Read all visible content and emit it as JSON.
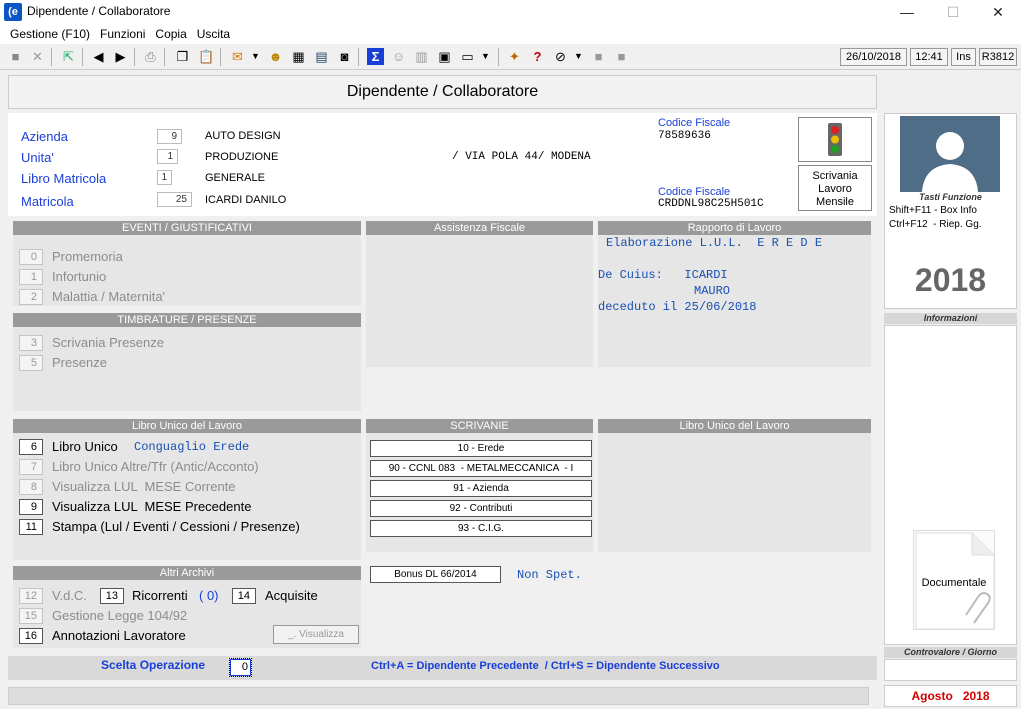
{
  "window": {
    "title": "Dipendente / Collaboratore",
    "app_icon": "(e",
    "minimize": "—",
    "maximize": "☐",
    "close": "✕"
  },
  "menu": [
    "Gestione (F10)",
    "Funzioni",
    "Copia",
    "Uscita"
  ],
  "status": {
    "date": "26/10/2018",
    "time": "12:41",
    "mode": "Ins",
    "code": "R3812"
  },
  "header": {
    "title": "Dipendente / Collaboratore"
  },
  "fields": {
    "azienda": {
      "label": "Azienda",
      "code": "9",
      "value": "AUTO DESIGN"
    },
    "unita": {
      "label": "Unita'",
      "code": "1",
      "value": "PRODUZIONE",
      "address": "/ VIA POLA 44/ MODENA"
    },
    "libro": {
      "label": "Libro Matricola",
      "code": "1",
      "value": "GENERALE"
    },
    "matricola": {
      "label": "Matricola",
      "code": "25",
      "value": "ICARDI DANILO"
    },
    "cf1": {
      "label": "Codice Fiscale",
      "value": "78589636"
    },
    "cf2": {
      "label": "Codice Fiscale",
      "value": "CRDDNL98C25H501C"
    }
  },
  "scrivania_btn": "Scrivania Lavoro Mensile",
  "eventi": {
    "title": "EVENTI / GIUSTIFICATIVI",
    "items": [
      {
        "num": "0",
        "label": "Promemoria"
      },
      {
        "num": "1",
        "label": "Infortunio"
      },
      {
        "num": "2",
        "label": "Malattia / Maternita'"
      }
    ]
  },
  "timbrature": {
    "title": "TIMBRATURE / PRESENZE",
    "items": [
      {
        "num": "3",
        "label": "Scrivania Presenze"
      },
      {
        "num": "5",
        "label": "Presenze"
      }
    ]
  },
  "assistenza": {
    "title": "Assistenza Fiscale"
  },
  "rapporto": {
    "title": "Rapporto di Lavoro",
    "line1": "Elaborazione L.U.L.  E R E D E",
    "line2": "De Cuius:   ICARDI",
    "line3": "MAURO",
    "line4": "deceduto il 25/06/2018"
  },
  "lul": {
    "title": "Libro Unico  del Lavoro",
    "items": [
      {
        "num": "6",
        "label": "Libro Unico",
        "extra": "Conguaglio Erede"
      },
      {
        "num": "7",
        "label": "Libro Unico Altre/Tfr (Antic/Acconto)"
      },
      {
        "num": "8",
        "label": "Visualizza LUL  MESE Corrente"
      },
      {
        "num": "9",
        "label": "Visualizza LUL  MESE Precedente"
      },
      {
        "num": "11",
        "label": "Stampa (Lul / Eventi / Cessioni / Presenze)"
      }
    ]
  },
  "scrivanie": {
    "title": "SCRIVANIE",
    "items": [
      "10 - Erede",
      "90 - CCNL 083  - METALMECCANICA  - I",
      "91 - Azienda",
      "92 - Contributi",
      "93 - C.I.G."
    ]
  },
  "lul2": {
    "title": "Libro Unico del Lavoro"
  },
  "altri": {
    "title": "Altri Archivi",
    "vdc_num": "12",
    "vdc": "V.d.C.",
    "ric_num": "13",
    "ric": "Ricorrenti",
    "ric_count": "( 0)",
    "acq_num": "14",
    "acq": "Acquisite",
    "legge_num": "15",
    "legge": "Gestione Legge 104/92",
    "ann_num": "16",
    "ann": "Annotazioni Lavoratore",
    "visualizza": "_. Visualizza"
  },
  "bonus": {
    "label": "Bonus DL 66/2014",
    "status": "Non Spet."
  },
  "footer": {
    "scelta_label": "Scelta Operazione",
    "scelta_value": "0",
    "hint": "Ctrl+A = Dipendente Precedente  / Ctrl+S = Dipendente Successivo"
  },
  "right": {
    "tasti_title": "Tasti Funzione",
    "shortcut1": "Shift+F11 - Box Info",
    "shortcut2": "Ctrl+F12  - Riep. Gg.",
    "year": "2018",
    "info_title": "Informazioni",
    "documentale": "Documentale",
    "contro_title": "Controvalore / Giorno",
    "period_month": "Agosto",
    "period_year": "2018"
  },
  "colors": {
    "accent_blue": "#1a3fd9",
    "panel_gray": "#e6e6e6",
    "section_header": "#9a9a9a",
    "period_red": "#d40000"
  }
}
